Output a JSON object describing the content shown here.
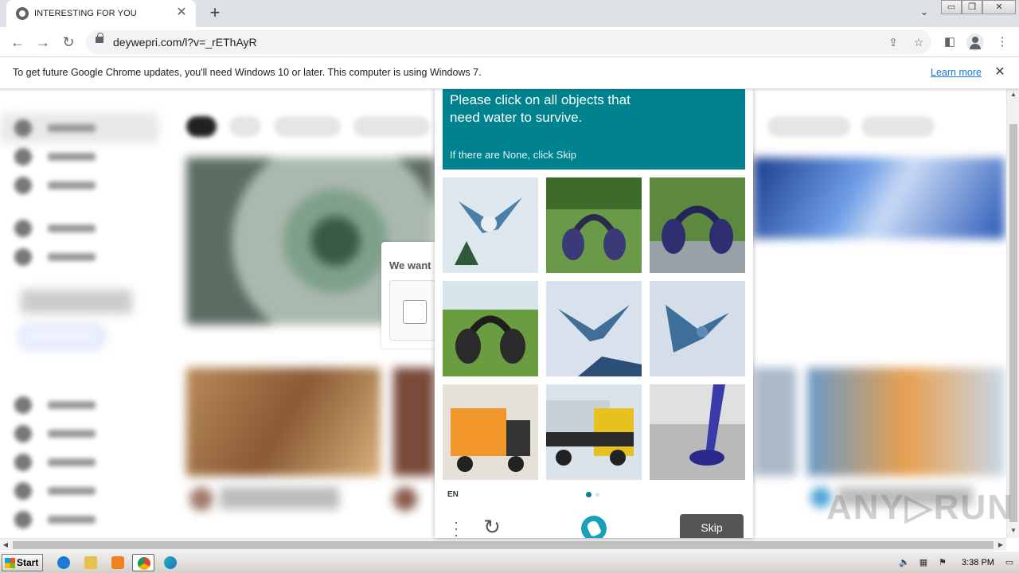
{
  "browser": {
    "tab_title": "INTERESTING FOR YOU",
    "tab_close": "✕",
    "new_tab": "+",
    "url": "deywepri.com/l?v=_rEThAyR",
    "window_controls": [
      "▭",
      "❐",
      "✕"
    ]
  },
  "infobar": {
    "message": "To get future Google Chrome updates, you'll need Windows 10 or later. This computer is using Windows 7.",
    "link": "Learn more",
    "close": "✕"
  },
  "background": {
    "widget_text": "We want"
  },
  "captcha": {
    "prompt": "Please click on all objects that need water to survive.",
    "sub": "If there are None, click Skip",
    "tiles": [
      {
        "name": "bird",
        "bg": "#dfe7ee"
      },
      {
        "name": "headphones",
        "bg": "#4d7a34"
      },
      {
        "name": "headphones",
        "bg": "#55803a"
      },
      {
        "name": "headphones",
        "bg": "#5a8a3c"
      },
      {
        "name": "bird",
        "bg": "#d9e2ec"
      },
      {
        "name": "bird",
        "bg": "#d4dde8"
      },
      {
        "name": "truck",
        "bg": "#e5e0d8"
      },
      {
        "name": "truck",
        "bg": "#dbe3ea"
      },
      {
        "name": "vacuum",
        "bg": "#b9b9b9"
      }
    ],
    "language": "EN",
    "skip_label": "Skip",
    "accent": "#00838f"
  },
  "watermark": "ANY▷RUN",
  "taskbar": {
    "start_label": "Start",
    "clock": "3:38 PM"
  }
}
